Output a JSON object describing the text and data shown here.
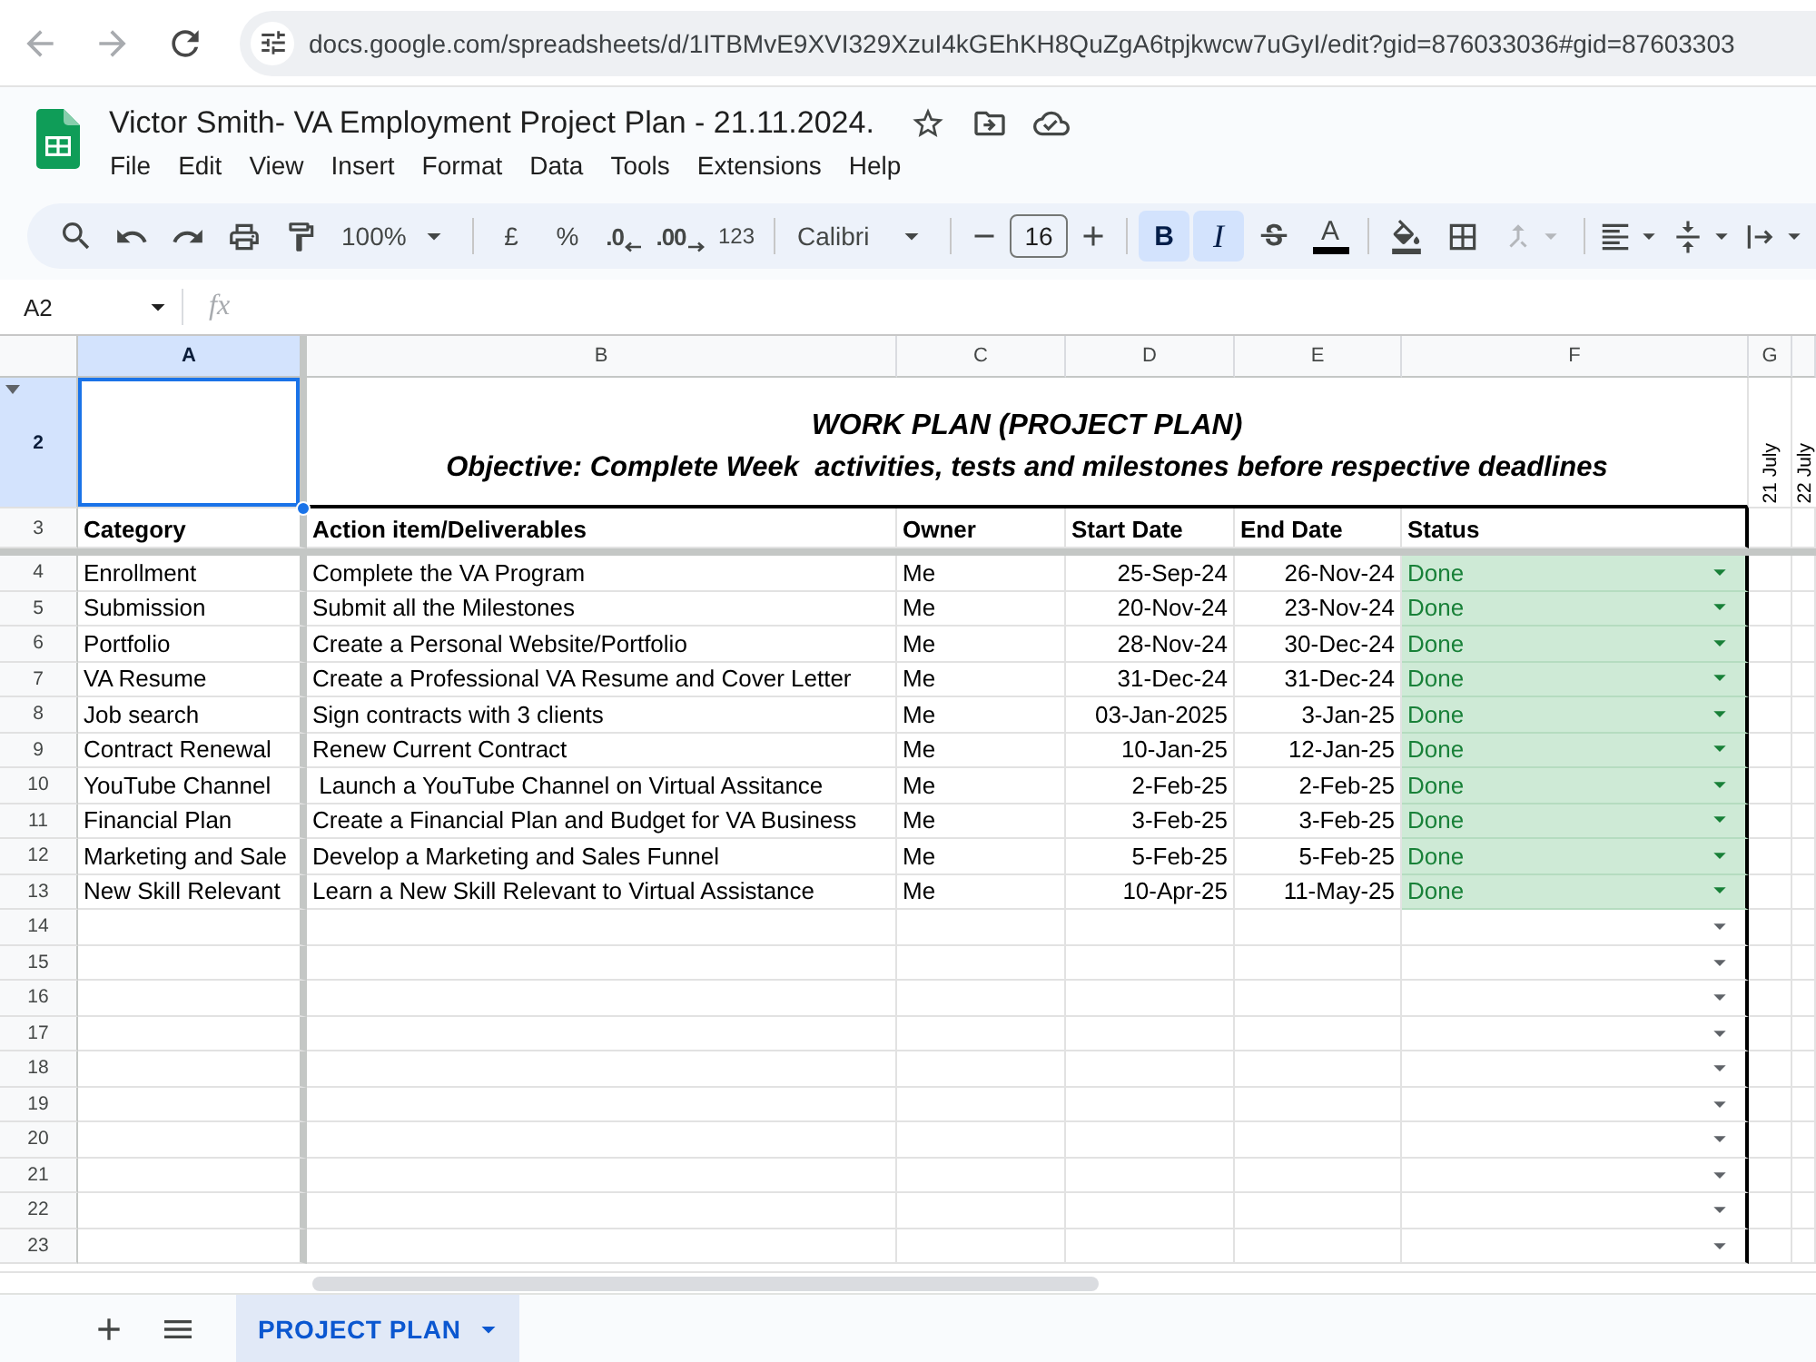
{
  "browser": {
    "back": {
      "disabled": true
    },
    "forward": {
      "disabled": true
    },
    "url": "docs.google.com/spreadsheets/d/1ITBMvE9XVI329XzuI4kGEhKH8QuZgA6tpjkwcw7uGyI/edit?gid=876033036#gid=87603303"
  },
  "document": {
    "title": "Victor Smith- VA Employment Project Plan - 21.11.2024."
  },
  "menu": [
    "File",
    "Edit",
    "View",
    "Insert",
    "Format",
    "Data",
    "Tools",
    "Extensions",
    "Help"
  ],
  "toolbar": {
    "zoom": "100%",
    "currency": "£",
    "percent": "%",
    "decrease_decimal": ".0",
    "increase_decimal": ".00",
    "number_format": "123",
    "font": "Calibri",
    "font_size": "16",
    "bold": {
      "label": "B",
      "on": true
    },
    "italic": {
      "label": "I",
      "on": true
    },
    "text_color": {
      "label": "A"
    },
    "merge_cells": {
      "disabled": true
    }
  },
  "formula_bar": {
    "cell": "A2",
    "fx": "fx"
  },
  "columns": [
    {
      "label": "A",
      "selected": true
    },
    {
      "label": "B",
      "selected": false
    },
    {
      "label": "C",
      "selected": false
    },
    {
      "label": "D",
      "selected": false
    },
    {
      "label": "E",
      "selected": false
    },
    {
      "label": "F",
      "selected": false
    },
    {
      "label": "G",
      "selected": false
    }
  ],
  "title_row": {
    "number": "2",
    "selected": true,
    "title": "WORK PLAN (PROJECT PLAN)",
    "objective": "Objective: Complete Week  activities, tests and milestones before respective deadlines",
    "rotated_labels": [
      "21 July",
      "22 July"
    ]
  },
  "header_row": {
    "number": "3",
    "selected": false,
    "cells": [
      "Category",
      "Action item/Deliverables",
      "Owner",
      "Start Date",
      "End Date",
      "Status"
    ]
  },
  "rows": [
    {
      "number": "4",
      "selected": false,
      "category": "Enrollment",
      "action": "Complete the VA Program",
      "owner": "Me",
      "start_date": "25-Sep-24",
      "end_date": "26-Nov-24",
      "status": "Done"
    },
    {
      "number": "5",
      "selected": false,
      "category": "Submission",
      "action": "Submit all the Milestones",
      "owner": "Me",
      "start_date": "20-Nov-24",
      "end_date": "23-Nov-24",
      "status": "Done"
    },
    {
      "number": "6",
      "selected": false,
      "category": "Portfolio",
      "action": "Create a Personal Website/Portfolio",
      "owner": "Me",
      "start_date": "28-Nov-24",
      "end_date": "30-Dec-24",
      "status": "Done"
    },
    {
      "number": "7",
      "selected": false,
      "category": "VA Resume",
      "action": "Create a Professional VA Resume and Cover Letter",
      "owner": "Me",
      "start_date": "31-Dec-24",
      "end_date": "31-Dec-24",
      "status": "Done"
    },
    {
      "number": "8",
      "selected": false,
      "category": "Job search",
      "action": "Sign contracts with 3 clients",
      "owner": "Me",
      "start_date": "03-Jan-2025",
      "end_date": "3-Jan-25",
      "status": "Done"
    },
    {
      "number": "9",
      "selected": false,
      "category": "Contract Renewal",
      "action": "Renew Current Contract",
      "owner": "Me",
      "start_date": "10-Jan-25",
      "end_date": "12-Jan-25",
      "status": "Done"
    },
    {
      "number": "10",
      "selected": false,
      "category": "YouTube Channel",
      "action": " Launch a YouTube Channel on Virtual Assitance",
      "owner": "Me",
      "start_date": "2-Feb-25",
      "end_date": "2-Feb-25",
      "status": "Done"
    },
    {
      "number": "11",
      "selected": false,
      "category": "Financial Plan",
      "action": "Create a Financial Plan and Budget for VA Business",
      "owner": "Me",
      "start_date": "3-Feb-25",
      "end_date": "3-Feb-25",
      "status": "Done"
    },
    {
      "number": "12",
      "selected": false,
      "category": "Marketing and Sale",
      "action": "Develop a Marketing and Sales Funnel",
      "owner": "Me",
      "start_date": "5-Feb-25",
      "end_date": "5-Feb-25",
      "status": "Done"
    },
    {
      "number": "13",
      "selected": false,
      "category": "New Skill Relevant",
      "action": "Learn a New Skill Relevant to Virtual Assistance",
      "owner": "Me",
      "start_date": "10-Apr-25",
      "end_date": "11-May-25",
      "status": "Done"
    }
  ],
  "empty_rows": [
    {
      "number": "14",
      "selected": false
    },
    {
      "number": "15",
      "selected": false
    },
    {
      "number": "16",
      "selected": false
    },
    {
      "number": "17",
      "selected": false
    },
    {
      "number": "18",
      "selected": false
    },
    {
      "number": "19",
      "selected": false
    },
    {
      "number": "20",
      "selected": false
    },
    {
      "number": "21",
      "selected": false
    },
    {
      "number": "22",
      "selected": false
    },
    {
      "number": "23",
      "selected": false
    }
  ],
  "sheet_tabs": [
    {
      "label": "PROJECT PLAN",
      "selected": true
    }
  ]
}
